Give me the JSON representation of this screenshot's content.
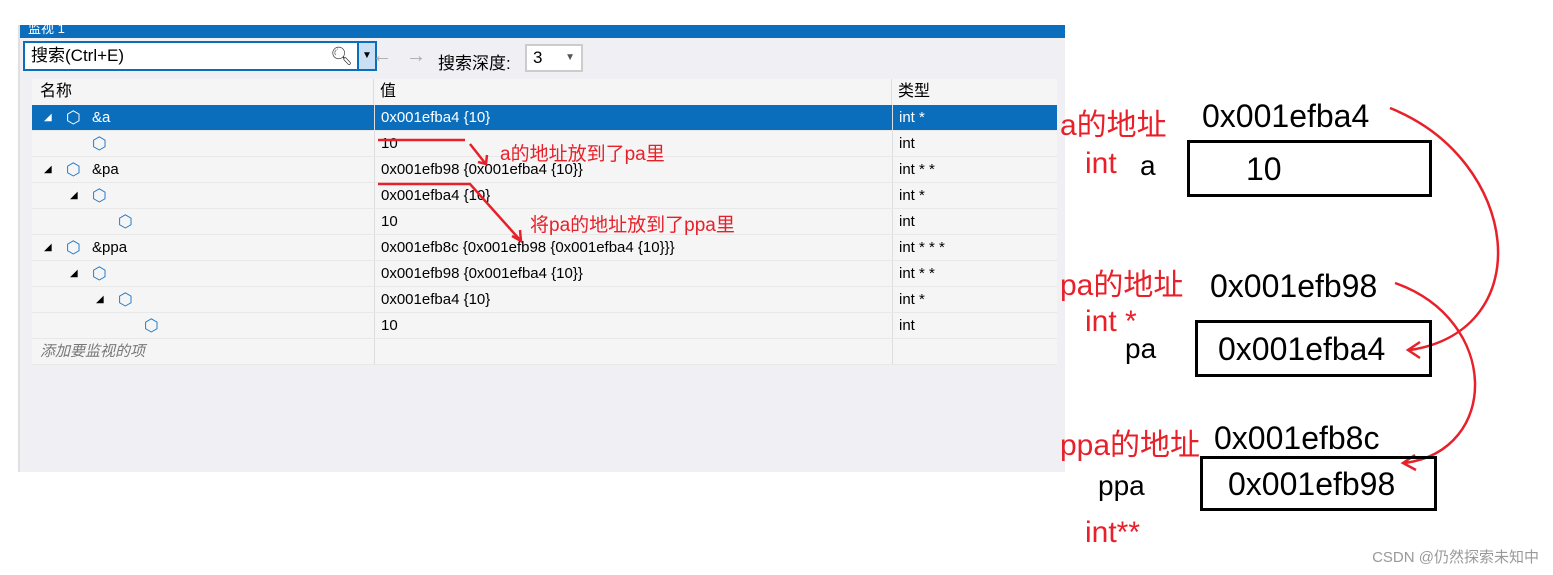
{
  "window": {
    "title": "监视 1",
    "search_placeholder": "搜索(Ctrl+E)",
    "depth_label": "搜索深度:",
    "depth_value": "3",
    "back": "←",
    "forward": "→"
  },
  "columns": {
    "name": "名称",
    "value": "值",
    "type": "类型"
  },
  "rows": [
    {
      "level": 0,
      "expand": true,
      "name": "&a",
      "value": "0x001efba4 {10}",
      "type": "int *",
      "selected": true
    },
    {
      "level": 1,
      "expand": false,
      "name": "",
      "value": "10",
      "type": "int"
    },
    {
      "level": 0,
      "expand": true,
      "name": "&pa",
      "value": "0x001efb98 {0x001efba4 {10}}",
      "type": "int * *"
    },
    {
      "level": 1,
      "expand": true,
      "name": "",
      "value": "0x001efba4 {10}",
      "type": "int *"
    },
    {
      "level": 2,
      "expand": false,
      "name": "",
      "value": "10",
      "type": "int"
    },
    {
      "level": 0,
      "expand": true,
      "name": "&ppa",
      "value": "0x001efb8c {0x001efb98 {0x001efba4 {10}}}",
      "type": "int * * *"
    },
    {
      "level": 1,
      "expand": true,
      "name": "",
      "value": "0x001efb98 {0x001efba4 {10}}",
      "type": "int * *"
    },
    {
      "level": 2,
      "expand": true,
      "name": "",
      "value": "0x001efba4 {10}",
      "type": "int *"
    },
    {
      "level": 3,
      "expand": false,
      "name": "",
      "value": "10",
      "type": "int"
    }
  ],
  "add_item": "添加要监视的项",
  "annotations": {
    "a_to_pa": "a的地址放到了pa里",
    "pa_to_ppa": "将pa的地址放到了ppa里"
  },
  "diagram": {
    "a": {
      "addr_label": "a的地址",
      "addr": "0x001efba4",
      "type": "int",
      "name": "a",
      "value": "10"
    },
    "pa": {
      "addr_label": "pa的地址",
      "addr": "0x001efb98",
      "type": "int *",
      "name": "pa",
      "value": "0x001efba4"
    },
    "ppa": {
      "addr_label": "ppa的地址",
      "addr": "0x001efb8c",
      "type": "int**",
      "name": "ppa",
      "value": "0x001efb98"
    }
  },
  "watermark": "CSDN @仍然探索未知中"
}
